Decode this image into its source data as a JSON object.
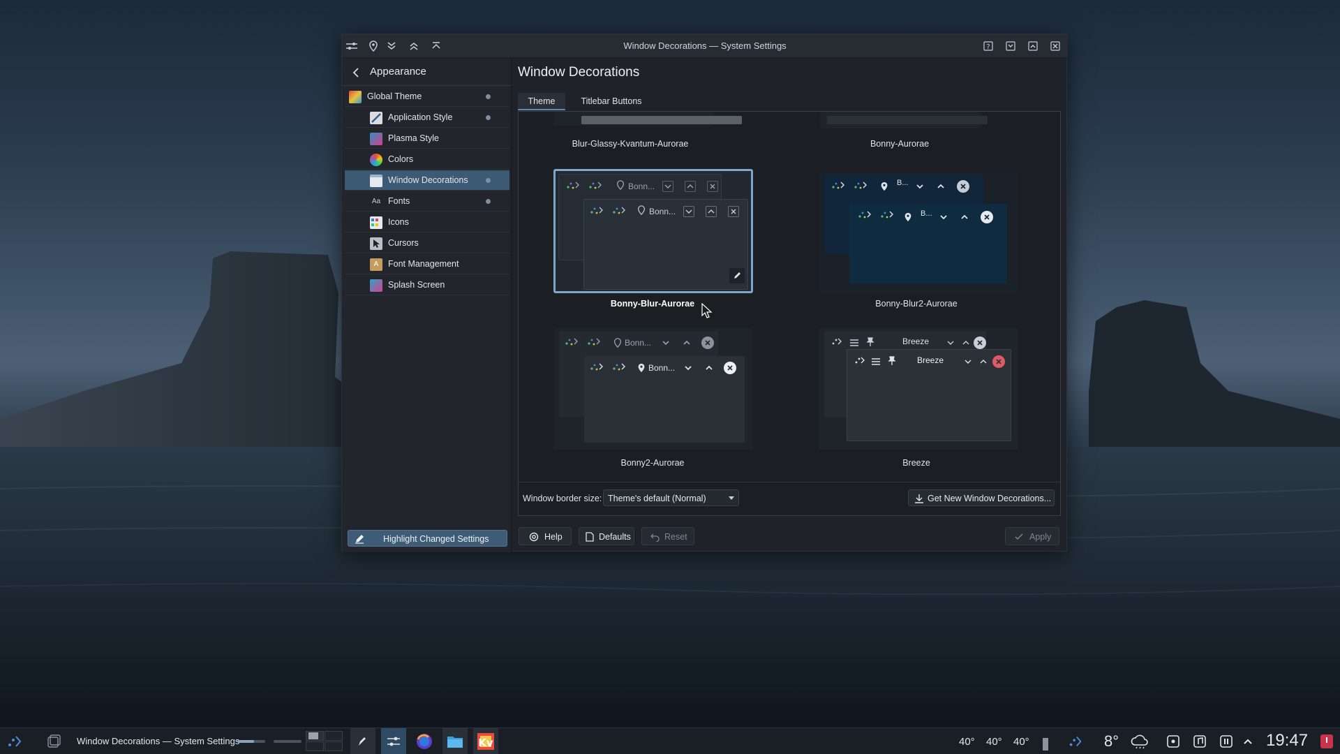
{
  "window": {
    "title": "Window Decorations — System Settings"
  },
  "sidebar": {
    "header": "Appearance",
    "items": [
      {
        "label": "Global Theme",
        "changed": true
      },
      {
        "label": "Application Style",
        "changed": true
      },
      {
        "label": "Plasma Style",
        "changed": false
      },
      {
        "label": "Colors",
        "changed": false
      },
      {
        "label": "Window Decorations",
        "changed": true,
        "active": true
      },
      {
        "label": "Fonts",
        "changed": true
      },
      {
        "label": "Icons",
        "changed": false
      },
      {
        "label": "Cursors",
        "changed": false
      },
      {
        "label": "Font Management",
        "changed": false
      },
      {
        "label": "Splash Screen",
        "changed": false
      }
    ],
    "highlight_button": "Highlight Changed Settings"
  },
  "main": {
    "title": "Window Decorations",
    "tabs": [
      {
        "label": "Theme",
        "active": true
      },
      {
        "label": "Titlebar Buttons",
        "active": false
      }
    ],
    "themes": [
      {
        "name": "Blur-Glassy-Kvantum-Aurorae"
      },
      {
        "name": "Bonny-Aurorae"
      },
      {
        "name": "Bonny-Blur-Aurorae",
        "selected": true,
        "title_text": "Bonn..."
      },
      {
        "name": "Bonny-Blur2-Aurorae",
        "title_text": "B..."
      },
      {
        "name": "Bonny2-Aurorae",
        "title_text": "Bonn..."
      },
      {
        "name": "Breeze",
        "title_text": "Breeze"
      }
    ],
    "border_size_label": "Window border size:",
    "border_size_value": "Theme's default (Normal)",
    "get_new_button": "Get New Window Decorations...",
    "footer": {
      "help": "Help",
      "defaults": "Defaults",
      "reset": "Reset",
      "apply": "Apply"
    }
  },
  "taskbar": {
    "task_title": "Window Decorations — System Settings",
    "temps": [
      "40°",
      "40°",
      "40°"
    ],
    "weather": "8°",
    "clock": "19:47"
  },
  "colors": {
    "accent": "#3d5a74",
    "selection": "#7fa6cc",
    "window_bg": "#1f2329"
  }
}
